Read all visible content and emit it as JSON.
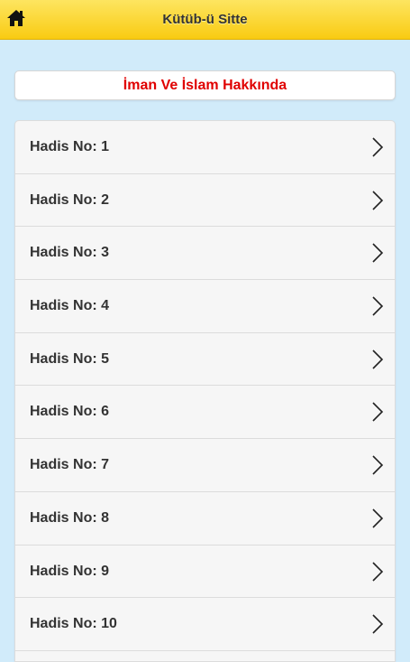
{
  "header": {
    "title": "Kütüb-ü Sitte",
    "home_icon": "home-icon"
  },
  "section": {
    "title": "İman Ve İslam Hakkında",
    "color": "#e00000"
  },
  "list": {
    "items": [
      {
        "label": "Hadis No: 1"
      },
      {
        "label": "Hadis No: 2"
      },
      {
        "label": "Hadis No: 3"
      },
      {
        "label": "Hadis No: 4"
      },
      {
        "label": "Hadis No: 5"
      },
      {
        "label": "Hadis No: 6"
      },
      {
        "label": "Hadis No: 7"
      },
      {
        "label": "Hadis No: 8"
      },
      {
        "label": "Hadis No: 9"
      },
      {
        "label": "Hadis No: 10"
      }
    ]
  },
  "colors": {
    "header_bg": "#f9cb12",
    "page_bg": "#d1ebfa"
  }
}
